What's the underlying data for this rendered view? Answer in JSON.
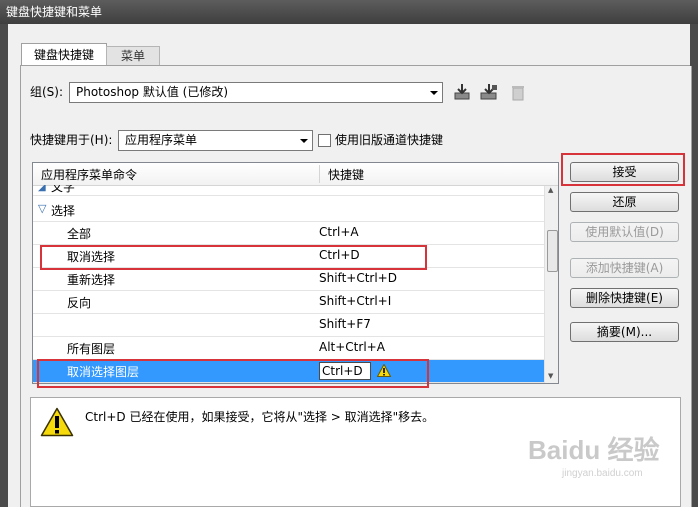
{
  "window": {
    "title": "键盘快捷键和菜单"
  },
  "tabs": [
    {
      "label": "键盘快捷键",
      "active": true
    },
    {
      "label": "菜单",
      "active": false
    }
  ],
  "group": {
    "label": "组(S):",
    "value": "Photoshop 默认值 (已修改)"
  },
  "shortcuts_for": {
    "label": "快捷键用于(H):",
    "value": "应用程序菜单"
  },
  "legacy_checkbox": {
    "label": "使用旧版通道快捷键",
    "checked": false
  },
  "table": {
    "headers": [
      "应用程序菜单命令",
      "快捷键"
    ],
    "partial_row": "文字",
    "group_row": "选择",
    "rows": [
      {
        "command": "全部",
        "shortcut": "Ctrl+A"
      },
      {
        "command": "取消选择",
        "shortcut": "Ctrl+D"
      },
      {
        "command": "重新选择",
        "shortcut": "Shift+Ctrl+D"
      },
      {
        "command": "反向",
        "shortcut": "Shift+Ctrl+I"
      },
      {
        "command": "",
        "shortcut": "Shift+F7"
      },
      {
        "command": "所有图层",
        "shortcut": "Alt+Ctrl+A"
      },
      {
        "command": "取消选择图层",
        "shortcut": "Ctrl+D",
        "selected": true,
        "editing": true
      }
    ]
  },
  "buttons": {
    "accept": "接受",
    "undo": "还原",
    "use_default": "使用默认值(D)",
    "add_shortcut": "添加快捷键(A)",
    "delete_shortcut": "删除快捷键(E)",
    "summary": "摘要(M)..."
  },
  "message": "Ctrl+D 已经在使用，如果接受，它将从\"选择 > 取消选择\"移去。",
  "watermark": {
    "brand": "Baidu 经验",
    "url": "jingyan.baidu.com"
  },
  "colors": {
    "selection": "#3399ff",
    "highlight_red": "#d7333b",
    "warning_yellow": "#f5d90a"
  }
}
